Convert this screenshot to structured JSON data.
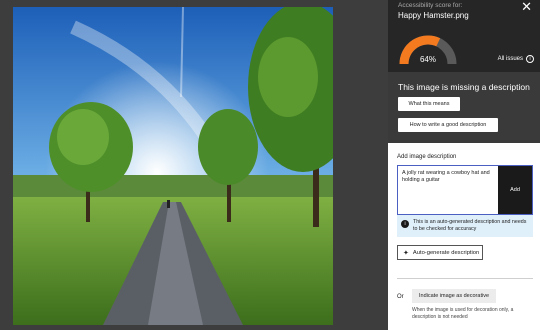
{
  "panel": {
    "score_label": "Accessibility score for:",
    "file_name": "Happy Hamster.png",
    "score_value": "64%",
    "score_fraction": 0.64,
    "all_issues": "All issues",
    "issue_title": "This image is missing a description",
    "what_means": "What this means",
    "how_to_write": "How to write a good description"
  },
  "form": {
    "section_label": "Add image description",
    "description": "A jolly rat wearing a cowboy hat and holding a guitar",
    "add_label": "Add",
    "notice": "This is an auto-generated description and needs to be checked for accuracy",
    "auto_generate": "Auto-generate description",
    "or_label": "Or",
    "decorative_label": "Indicate image as decorative",
    "decorative_note": "When the image is used for decoration only, a description is not needed"
  },
  "colors": {
    "gauge_fill": "#f47a20",
    "gauge_track": "#5a5a5a",
    "accent_border": "#4a5fc1",
    "notice_bg": "#dff0fb"
  }
}
